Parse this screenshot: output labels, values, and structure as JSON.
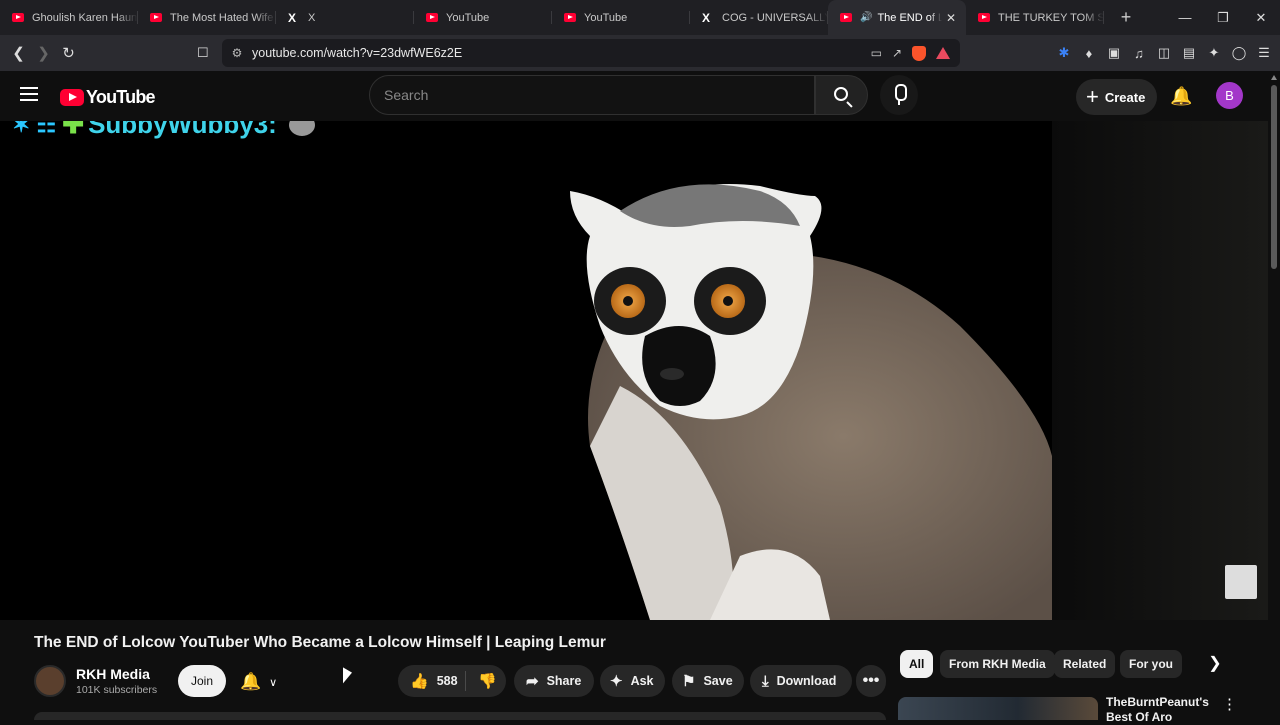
{
  "browser": {
    "tabs": [
      {
        "title": "Ghoulish Karen Haunt",
        "icon": "youtube-icon"
      },
      {
        "title": "The Most Hated Wife",
        "icon": "youtube-icon"
      },
      {
        "title": "X",
        "icon": "x-icon"
      },
      {
        "title": "YouTube",
        "icon": "youtube-icon"
      },
      {
        "title": "YouTube",
        "icon": "youtube-icon"
      },
      {
        "title": "COG - UNIVERSALLY",
        "icon": "x-icon"
      },
      {
        "title": "The END of Lo",
        "icon": "youtube-icon",
        "active": true,
        "audio": true
      },
      {
        "title": "THE TURKEY TOM SIT",
        "icon": "youtube-icon"
      }
    ],
    "new_tab": "+",
    "url": "youtube.com/watch?v=23dwfWE6z2E",
    "window_controls": {
      "minimize": "—",
      "restore": "❐",
      "close": "✕"
    }
  },
  "youtube": {
    "logo_text": "YouTube",
    "search_placeholder": "Search",
    "create_label": "Create",
    "create_plus": "+",
    "avatar_letter": "B",
    "bell": "🔔"
  },
  "video": {
    "overlay_name": "SubbyWubby3:",
    "overlay_tags": "✶ ☷",
    "overlay_gem": "✚",
    "title": "The END of Lolcow YouTuber Who Became a Lolcow Himself | Leaping Lemur",
    "channel": {
      "name": "RKH Media",
      "subscribers": "101K subscribers"
    },
    "join_label": "Join",
    "likes": "588",
    "actions": {
      "share": "Share",
      "ask": "Ask",
      "save": "Save",
      "download": "Download",
      "more": "•••"
    }
  },
  "chips": [
    "All",
    "From RKH Media",
    "Related",
    "For you"
  ],
  "recommendation": {
    "channel_line1": "TheBurntPeanut's",
    "channel_line2": "Best Of Aro"
  },
  "colors": {
    "accent": "#ff0033",
    "avatar_bg": "#a337c9",
    "background": "#0f0f0f"
  }
}
